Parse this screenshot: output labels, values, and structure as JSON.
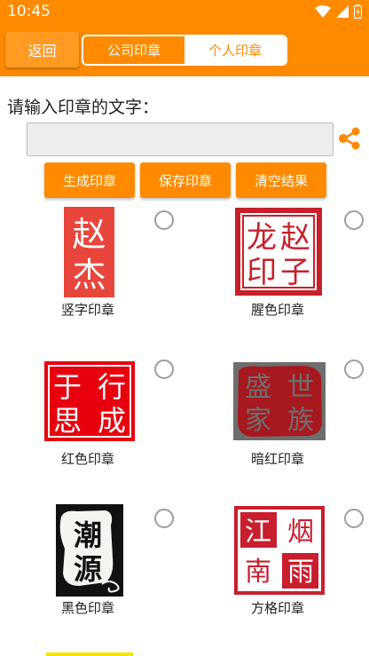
{
  "status": {
    "time": "10:45"
  },
  "header": {
    "back_label": "返回",
    "tabs": [
      {
        "label": "公司印章",
        "active": false
      },
      {
        "label": "个人印章",
        "active": true
      }
    ]
  },
  "input": {
    "prompt": "请输入印章的文字：",
    "value": "",
    "placeholder": ""
  },
  "actions": [
    {
      "label": "生成印章"
    },
    {
      "label": "保存印章"
    },
    {
      "label": "清空结果"
    }
  ],
  "seals": [
    {
      "caption": "竖字印章",
      "chars": [
        "赵",
        "杰"
      ],
      "color": "#e8453c",
      "selected": false
    },
    {
      "caption": "腥色印章",
      "chars": [
        "龙",
        "赵",
        "印",
        "子"
      ],
      "color": "#c8202a",
      "selected": false
    },
    {
      "caption": "红色印章",
      "chars": [
        "行",
        "成",
        "于",
        "思"
      ],
      "color": "#e8000e",
      "selected": false
    },
    {
      "caption": "暗红印章",
      "chars": [
        "世",
        "族",
        "盛",
        "家"
      ],
      "color": "#a8181f",
      "selected": false
    },
    {
      "caption": "黑色印章",
      "chars": [
        "潮",
        "源"
      ],
      "color": "#111111",
      "selected": false
    },
    {
      "caption": "方格印章",
      "chars": [
        "烟",
        "雨",
        "江",
        "南"
      ],
      "color": "#c81e2e",
      "selected": false
    }
  ],
  "colors": {
    "accent": "#ff8a00",
    "background": "#ffffff"
  }
}
